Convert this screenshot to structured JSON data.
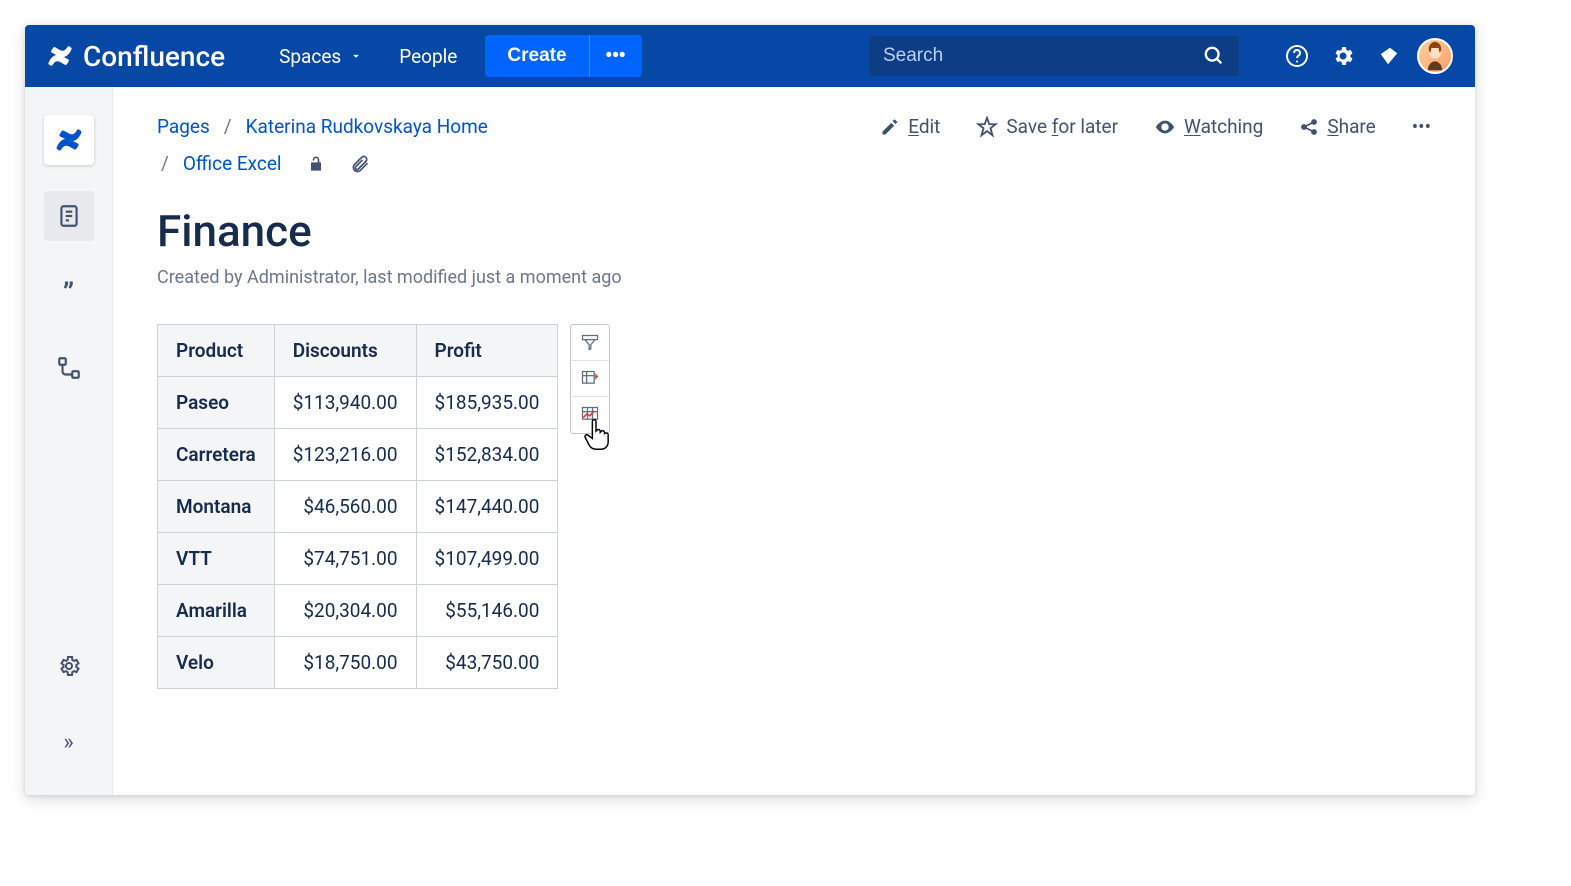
{
  "topnav": {
    "app_name": "Confluence",
    "menu_spaces": "Spaces",
    "menu_people": "People",
    "create_label": "Create",
    "more_glyph": "•••",
    "search_placeholder": "Search"
  },
  "breadcrumb": {
    "pages": "Pages",
    "home": "Katerina Rudkovskaya Home",
    "current": "Office Excel"
  },
  "page_actions": {
    "edit": "Edit",
    "save": "Save for later",
    "watching": "Watching",
    "share": "Share",
    "more_glyph": "•••"
  },
  "page": {
    "title": "Finance",
    "meta": "Created by Administrator, last modified just a moment ago"
  },
  "table": {
    "headers": {
      "product": "Product",
      "discounts": "Discounts",
      "profit": "Profit"
    },
    "rows": [
      {
        "product": "Paseo",
        "discounts": "$113,940.00",
        "profit": "$185,935.00"
      },
      {
        "product": "Carretera",
        "discounts": "$123,216.00",
        "profit": "$152,834.00"
      },
      {
        "product": "Montana",
        "discounts": "$46,560.00",
        "profit": "$147,440.00"
      },
      {
        "product": "VTT",
        "discounts": "$74,751.00",
        "profit": "$107,499.00"
      },
      {
        "product": "Amarilla",
        "discounts": "$20,304.00",
        "profit": "$55,146.00"
      },
      {
        "product": "Velo",
        "discounts": "$18,750.00",
        "profit": "$43,750.00"
      }
    ]
  }
}
